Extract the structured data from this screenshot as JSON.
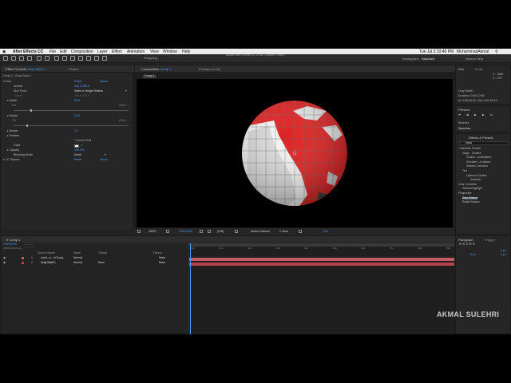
{
  "menubar": {
    "app_name": "After Effects CC",
    "items": [
      "File",
      "Edit",
      "Composition",
      "Layer",
      "Effect",
      "Animation",
      "View",
      "Window",
      "Help"
    ],
    "clock": "Tue Jul 3  10:46 PM",
    "user": "MuhammadAkmal",
    "search_icon": "search-icon"
  },
  "toolbar": {
    "title": "Adobe After Effects CC 2018 - Untitled Project",
    "snapping": "Snapping",
    "workspace_label": "Workspace:",
    "workspace_value": "Standard",
    "search_help_placeholder": "Search Help"
  },
  "effect_controls": {
    "tab_label": "Effect Controls",
    "tab_target": "Gray Solid 1",
    "project_tab": "Project",
    "layer_path": "Comp 1 • Gray Solid 1",
    "effects": [
      {
        "name": "Grid",
        "reset": "Reset",
        "about": "About..."
      },
      {
        "name": "CC Sphere",
        "reset": "Reset",
        "about": "About..."
      }
    ],
    "params": {
      "anchor": {
        "label": "Anchor",
        "value": "640.0,360.0"
      },
      "size_from": {
        "label": "Size From",
        "value": "Width & Height Sliders"
      },
      "corner": {
        "label": "Corner",
        "value": "768.0,432.0"
      },
      "width": {
        "label": "Width",
        "value": "30.0",
        "min": "0.0",
        "max": "200.0"
      },
      "height": {
        "label": "Height",
        "value": "24.0",
        "min": "0.0",
        "max": "200.0"
      },
      "border": {
        "label": "Border",
        "value": "1.0"
      },
      "feather": {
        "label": "Feather"
      },
      "invert_grid": {
        "label": "Invert Grid"
      },
      "color": {
        "label": "Color",
        "swatch": "#ffffff"
      },
      "opacity": {
        "label": "Opacity",
        "value": "100.0%"
      },
      "blending_mode": {
        "label": "Blending Mode",
        "value": "None"
      }
    }
  },
  "composition": {
    "tab_label": "Composition",
    "tab_target": "Comp 1",
    "footage_tab": "Footage (none)",
    "sub_tab": "Comp 1",
    "zoom": "100%",
    "timecode": "0:00:00:00",
    "resolution": "(Full)",
    "camera": "Active Camera",
    "views": "1 View",
    "exposure": "+0.0"
  },
  "info_panel": {
    "tab_info": "Info",
    "tab_audio": "Audio",
    "x": "X : 1080",
    "y": "Y : 379",
    "layer_name": "Gray Solid 1",
    "duration": "Duration: 0:00:10:00",
    "in_out": "In: 0:00:00:00, Out: 0:01:59:24"
  },
  "preview_panel": {
    "title": "Preview",
    "shortcut_label": "Shortcut",
    "shortcut_value": "Spacebar"
  },
  "effects_presets": {
    "title": "Effects & Presets",
    "search_value": "shad",
    "tree": [
      {
        "label": "* Animation Presets",
        "level": 0
      },
      {
        "label": "Image - Creative",
        "level": 1
      },
      {
        "label": "Colorful...constellation",
        "level": 2
      },
      {
        "label": "Shredded...a shadow",
        "level": 2
      },
      {
        "label": "Shadow...extrusion",
        "level": 2
      },
      {
        "label": "Text",
        "level": 1
      },
      {
        "label": "Lights and Optical",
        "level": 2
      },
      {
        "label": "Shadows",
        "level": 3
      },
      {
        "label": "Color Correction",
        "level": 0
      },
      {
        "label": "Shadow/Highlight",
        "level": 1
      },
      {
        "label": "Perspective",
        "level": 0
      },
      {
        "label": "Drop Shadow",
        "level": 1
      },
      {
        "label": "Radial Shadow",
        "level": 1
      }
    ],
    "selected_index": 11
  },
  "timeline": {
    "tab_label": "Comp 1",
    "timecode": "0:00:00:00",
    "fps": "00000 (25.00 fps)",
    "headers": {
      "source": "Source Name",
      "mode": "Mode",
      "trkmat": "TrkMat",
      "parent": "Parent"
    },
    "layers": [
      {
        "num": "1",
        "name": "world_m...4X9.png",
        "mode": "Normal",
        "trkmat": "",
        "parent": "None"
      },
      {
        "num": "2",
        "name": "Gray Solid 1",
        "mode": "Normal",
        "trkmat": "None",
        "parent": "None"
      }
    ],
    "ruler_marks": [
      "00s",
      "01s",
      "02s",
      "03s",
      "04s",
      "05s",
      "06s",
      "07s",
      "08s",
      "09s"
    ]
  },
  "paragraph_panel": {
    "tab_paragraph": "Paragraph",
    "tab_wiggler": "Wiggler",
    "values": [
      "0 px",
      "0 px",
      "0 px",
      "0 px",
      "0 px"
    ]
  },
  "watermark": "AKMAL SULEHRI",
  "colors": {
    "accent_blue": "#4a9bff",
    "globe_red": "#e01f1f",
    "layer_red": "#c45a63",
    "track_red": "#b3424e"
  }
}
